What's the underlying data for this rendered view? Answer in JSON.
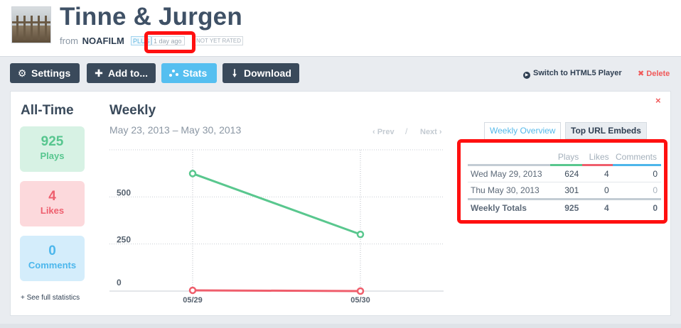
{
  "video": {
    "title": "Tinne & Jurgen",
    "from_prefix": "from",
    "owner": "NOAFILM",
    "plus_badge": "PLUS",
    "age_badge": "1 day ago",
    "rating_badge": "NOT YET RATED"
  },
  "toolbar": {
    "settings": "Settings",
    "add_to": "Add to...",
    "stats": "Stats",
    "download": "Download",
    "html5": "Switch to HTML5 Player",
    "delete": "Delete"
  },
  "icons": {
    "settings": "gear-icon",
    "add_to": "plus-icon",
    "stats": "stats-icon",
    "download": "download-arrow-icon",
    "html5": "play-circle-icon",
    "delete": "x-icon",
    "close": "close-icon"
  },
  "panel": {
    "close": "×",
    "all_time_title": "All-Time",
    "plays_value": "925",
    "plays_label": "Plays",
    "likes_value": "4",
    "likes_label": "Likes",
    "comments_value": "0",
    "comments_label": "Comments",
    "full_stats_link": "+ See full statistics",
    "weekly_title": "Weekly",
    "date_range": "May 23, 2013 – May 30, 2013",
    "prev": "‹ Prev",
    "separator": "/",
    "next": "Next ›"
  },
  "tabs": {
    "overview": "Weekly Overview",
    "embeds": "Top URL Embeds"
  },
  "table": {
    "headers": [
      "",
      "Plays",
      "Likes",
      "Comments"
    ],
    "rows": [
      [
        "Wed May 29, 2013",
        "624",
        "4",
        "0"
      ],
      [
        "Thu May 30, 2013",
        "301",
        "0",
        "0"
      ]
    ],
    "totals": [
      "Weekly Totals",
      "925",
      "4",
      "0"
    ]
  },
  "colors": {
    "plays": "#59c78e",
    "likes": "#ef5e6c",
    "comments": "#4db6ea",
    "highlight": "#ff1010"
  },
  "chart_data": {
    "type": "line",
    "x": [
      "05/29",
      "05/30"
    ],
    "series": [
      {
        "name": "Plays",
        "values": [
          624,
          301
        ],
        "color": "#59c78e"
      },
      {
        "name": "Likes",
        "values": [
          4,
          0
        ],
        "color": "#ef5e6c"
      }
    ],
    "yticks": [
      0,
      250,
      500
    ],
    "ylim": [
      0,
      750
    ],
    "grid": true
  }
}
